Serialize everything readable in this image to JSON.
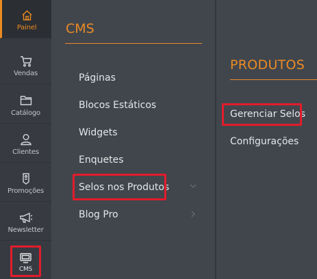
{
  "nav": {
    "items": [
      {
        "label": "Painel",
        "icon": "home-icon"
      },
      {
        "label": "Vendas",
        "icon": "cart-icon"
      },
      {
        "label": "Catálogo",
        "icon": "folder-icon"
      },
      {
        "label": "Clientes",
        "icon": "person-icon"
      },
      {
        "label": "Promoções",
        "icon": "tag-icon"
      },
      {
        "label": "Newsletter",
        "icon": "megaphone-icon"
      },
      {
        "label": "CMS",
        "icon": "monitor-icon"
      }
    ]
  },
  "cms": {
    "title": "CMS",
    "links": [
      "Páginas",
      "Blocos Estáticos",
      "Widgets",
      "Enquetes",
      "Selos nos Produtos",
      "Blog Pro"
    ]
  },
  "produtos": {
    "title": "PRODUTOS",
    "links": [
      "Gerenciar Selos",
      "Configurações"
    ]
  },
  "colors": {
    "accent": "#eb8a24",
    "highlight": "#e31c2c",
    "panel": "#41464d",
    "nav": "#373b41"
  }
}
